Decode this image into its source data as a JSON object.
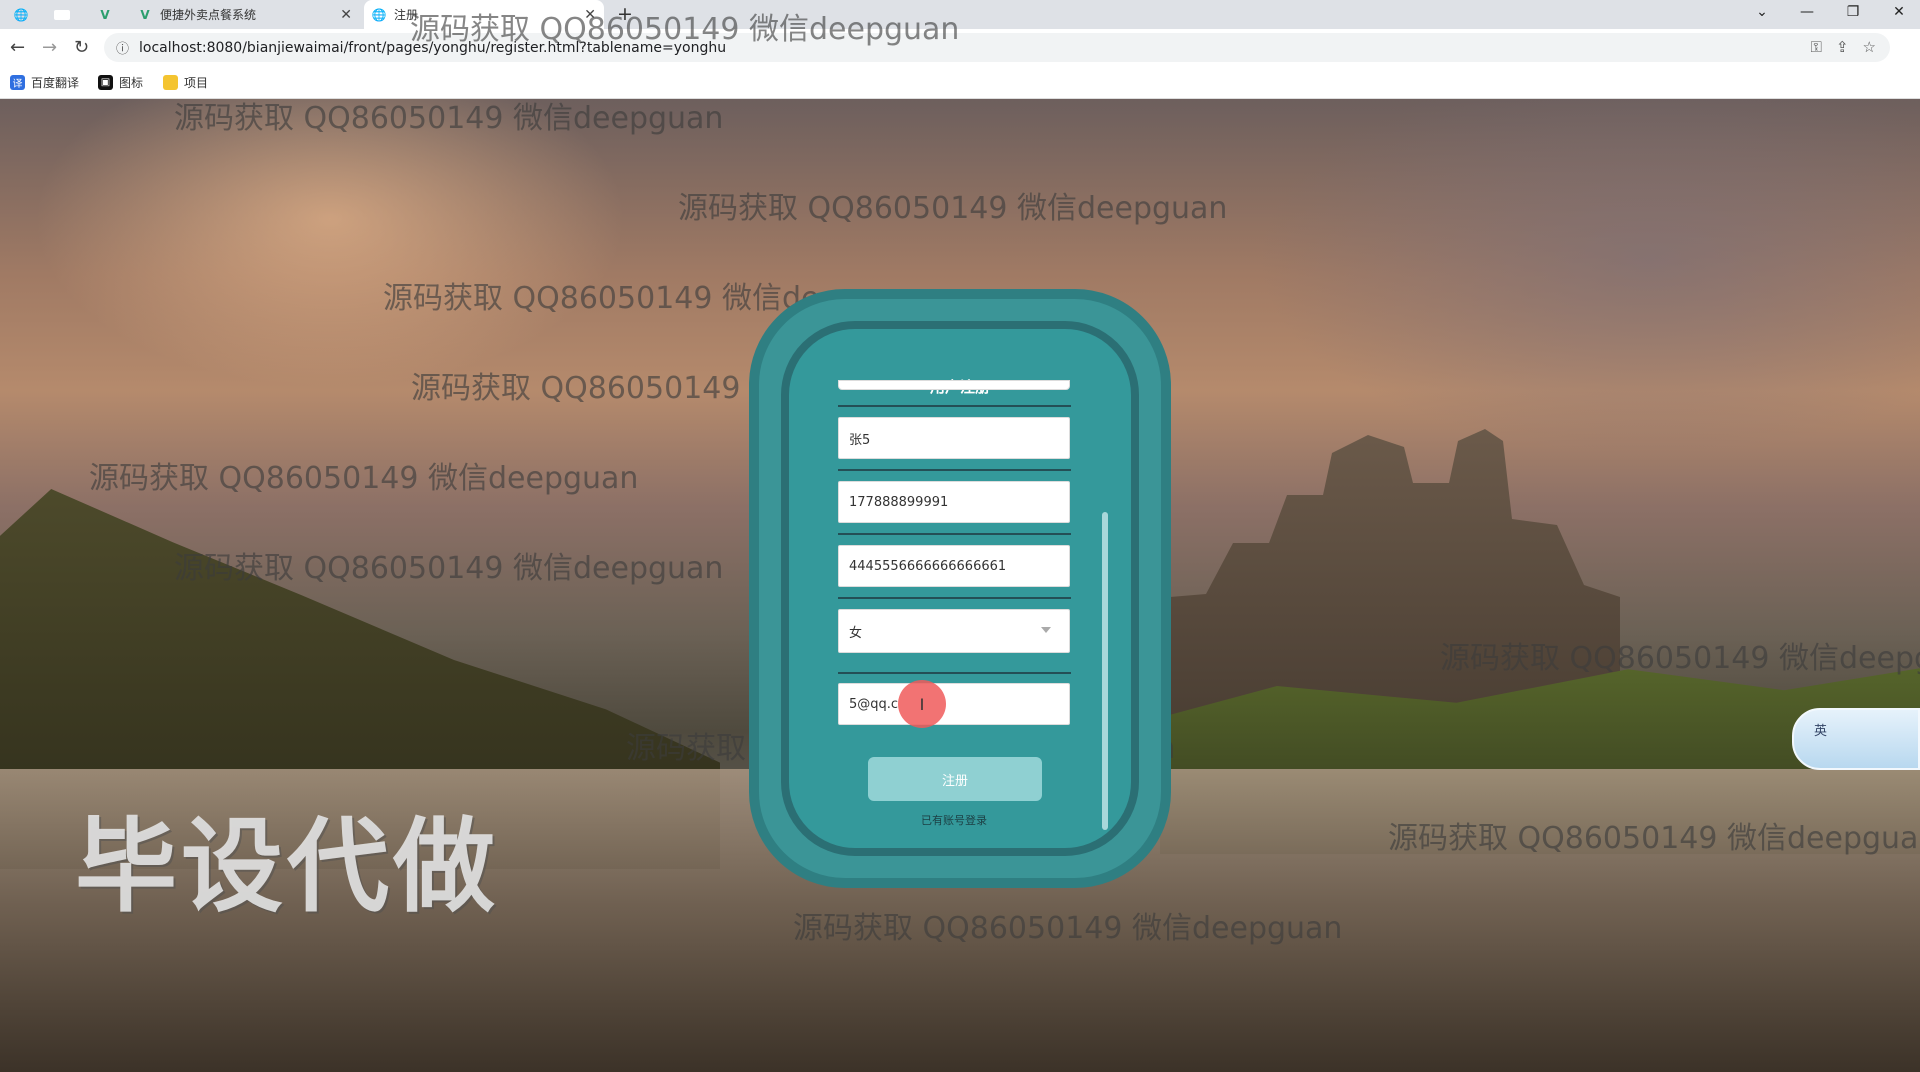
{
  "browser": {
    "tabs": [
      {
        "label": "",
        "active": false
      },
      {
        "label": "",
        "active": false
      },
      {
        "label": "",
        "active": false
      },
      {
        "label": "便捷外卖点餐系统",
        "active": false
      },
      {
        "label": "注册",
        "active": true
      }
    ],
    "url": "localhost:8080/bianjiewaimai/front/pages/yonghu/register.html?tablename=yonghu",
    "bookmarks": [
      {
        "label": "百度翻译",
        "icon": "translate-icon",
        "color": "#2f6fe0"
      },
      {
        "label": "图标",
        "icon": "image-icon",
        "color": "#111111"
      },
      {
        "label": "项目",
        "icon": "folder-icon",
        "color": "#f4c430"
      }
    ]
  },
  "watermarks": [
    "源码获取 QQ86050149 微信deepguan",
    "源码获取 QQ86050149 微信deepguan",
    "源码获取 QQ86050149 微信deepguan",
    "源码获取 QQ86050149 微信deepguan",
    "源码获取 QQ86050149 微信deepguan",
    "源码获取 QQ86050149 微信deepguan",
    "源码获取 QQ86050149 微信deepguan",
    "源码获取 QQ86050149 微信deepguan",
    "源码获取 QQ86050149 微信deepguan",
    "源码获取 QQ86050149 微信deepguan",
    "源码获取 QQ86050149 微信deepguan"
  ],
  "stamp": "毕设代做",
  "register": {
    "title": "用户注册",
    "fields": {
      "name": "张5",
      "phone": "177888899991",
      "id_card": "4445556666666666661",
      "gender": "女",
      "email": "5@qq.c"
    },
    "submit_label": "注册",
    "login_link": "已有账号登录"
  },
  "ime": {
    "label": "英"
  },
  "colors": {
    "card": "#3b9597",
    "card_border": "#2f7f82",
    "button": "#8fd0d2"
  }
}
